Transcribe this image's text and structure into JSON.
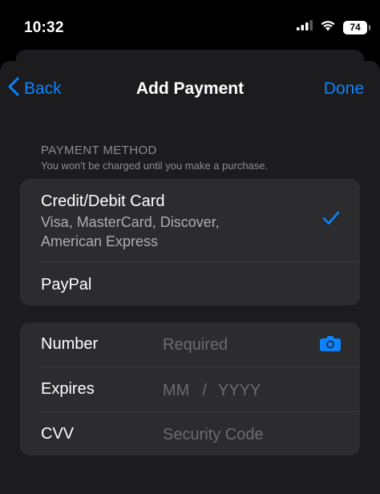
{
  "status_bar": {
    "time": "10:32",
    "battery": "74"
  },
  "nav": {
    "back_label": "Back",
    "title": "Add Payment",
    "done_label": "Done"
  },
  "payment_method": {
    "header": "PAYMENT METHOD",
    "footnote": "You won't be charged until you make a purchase.",
    "options": [
      {
        "title": "Credit/Debit Card",
        "subtitle_line1": "Visa, MasterCard, Discover,",
        "subtitle_line2": "American Express",
        "selected": true
      },
      {
        "title": "PayPal",
        "selected": false
      }
    ]
  },
  "card_fields": {
    "number_label": "Number",
    "number_placeholder": "Required",
    "expires_label": "Expires",
    "expires_month_placeholder": "MM",
    "expires_separator": "/",
    "expires_year_placeholder": "YYYY",
    "cvv_label": "CVV",
    "cvv_placeholder": "Security Code"
  },
  "colors": {
    "accent": "#0a84ff",
    "background": "#000000",
    "sheet": "#1c1c1e",
    "group": "#2c2c2e",
    "secondary_text": "#8d8d93"
  },
  "icons": {
    "back": "chevron-left-icon",
    "check": "checkmark-icon",
    "camera": "camera-icon",
    "signal": "cellular-signal-icon",
    "wifi": "wifi-icon",
    "battery": "battery-icon"
  }
}
